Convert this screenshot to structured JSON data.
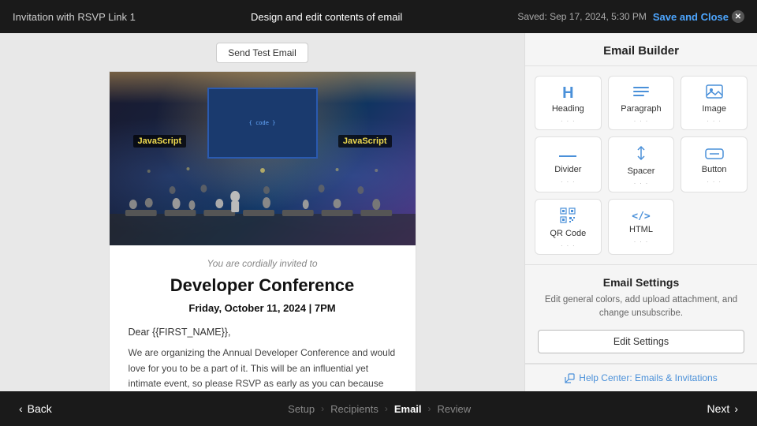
{
  "topbar": {
    "left_label": "Invitation with RSVP Link 1",
    "center_label": "Design and edit contents of email",
    "saved_text": "Saved: Sep 17, 2024, 5:30 PM",
    "save_close_label": "Save and Close"
  },
  "canvas": {
    "send_test_label": "Send Test Email",
    "cordially_text": "You are cordially invited to",
    "conference_title": "Developer Conference",
    "conference_date": "Friday, October 11, 2024 | 7PM",
    "dear_text": "Dear {{FIRST_NAME}},",
    "body_text": "We are organizing the Annual Developer Conference and would love for you to be a part of it. This will be an influential yet intimate event, so please RSVP as early as you can because space is limited. We look forward to seeing you soon."
  },
  "sidebar": {
    "title": "Email Builder",
    "components": [
      {
        "id": "heading",
        "label": "Heading",
        "icon": "H"
      },
      {
        "id": "paragraph",
        "label": "Paragraph",
        "icon": "≡"
      },
      {
        "id": "image",
        "label": "Image",
        "icon": "🖼"
      },
      {
        "id": "divider",
        "label": "Divider",
        "icon": "—"
      },
      {
        "id": "spacer",
        "label": "Spacer",
        "icon": "⇕"
      },
      {
        "id": "button",
        "label": "Button",
        "icon": "□"
      },
      {
        "id": "qr-code",
        "label": "QR Code",
        "icon": "▦"
      },
      {
        "id": "html",
        "label": "HTML",
        "icon": "</>"
      }
    ],
    "settings_title": "Email Settings",
    "settings_desc": "Edit general colors, add upload attachment, and change unsubscribe.",
    "edit_settings_label": "Edit Settings",
    "help_link_label": "Help Center: Emails & Invitations"
  },
  "bottomnav": {
    "back_label": "Back",
    "next_label": "Next",
    "steps": [
      {
        "id": "setup",
        "label": "Setup"
      },
      {
        "id": "recipients",
        "label": "Recipients"
      },
      {
        "id": "email",
        "label": "Email",
        "active": true
      },
      {
        "id": "review",
        "label": "Review"
      }
    ]
  }
}
